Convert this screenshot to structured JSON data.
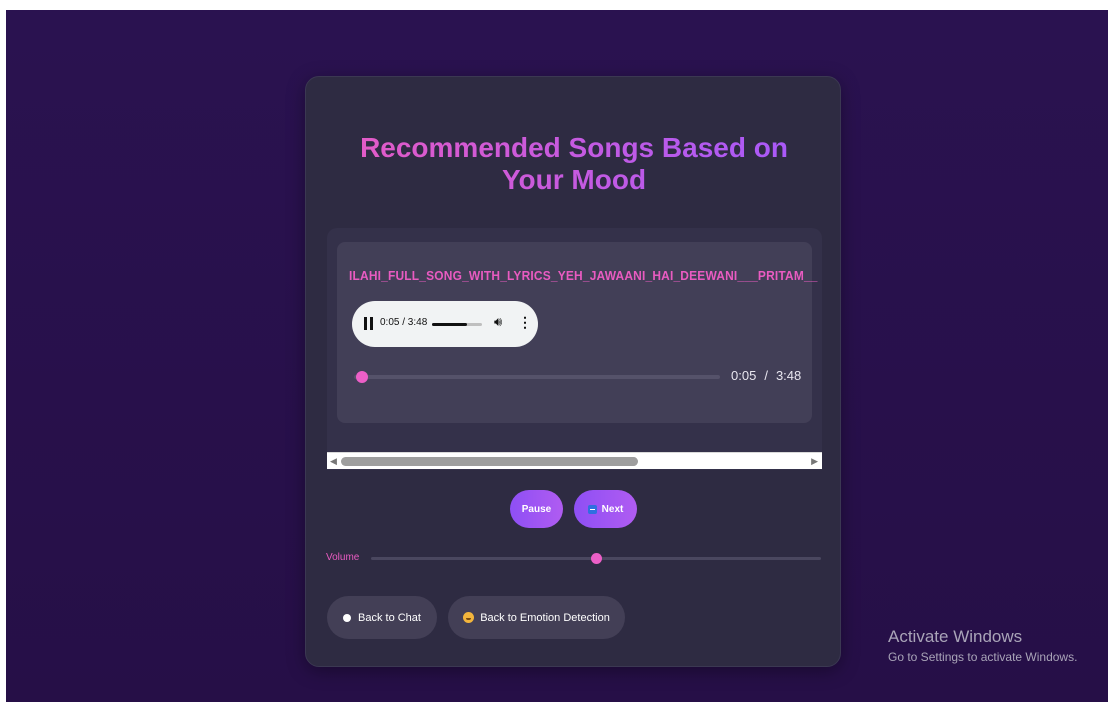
{
  "page": {
    "title": "Recommended Songs Based on Your Mood"
  },
  "player": {
    "song_title": "ILAHI_FULL_SONG_WITH_LYRICS_YEH_JAWAANI_HAI_DEEWANI___PRITAM__",
    "native_time": "0:05 / 3:48",
    "native_volume_fraction": 0.7,
    "current_time": "0:05",
    "separator": "/",
    "duration": "3:48",
    "progress_fraction": 0.023
  },
  "scroll": {
    "thumb_fraction": 0.6
  },
  "controls": {
    "pause_label": "Pause",
    "next_label": "Next",
    "volume_label": "Volume",
    "volume_fraction": 0.5
  },
  "nav": {
    "back_chat_label": "Back to Chat",
    "back_emotion_label": "Back to Emotion Detection"
  },
  "watermark": {
    "title": "Activate Windows",
    "subtitle": "Go to Settings to activate Windows."
  },
  "colors": {
    "accent_pink": "#e95bc1",
    "accent_purple": "#a259ff",
    "card_bg": "#2e2b42",
    "page_bg": "#2a1250"
  },
  "icons": [
    "pause-icon",
    "volume-icon",
    "more-options-icon",
    "next-icon",
    "chat-bubble-icon",
    "smiley-icon",
    "scroll-left-icon",
    "scroll-right-icon"
  ]
}
